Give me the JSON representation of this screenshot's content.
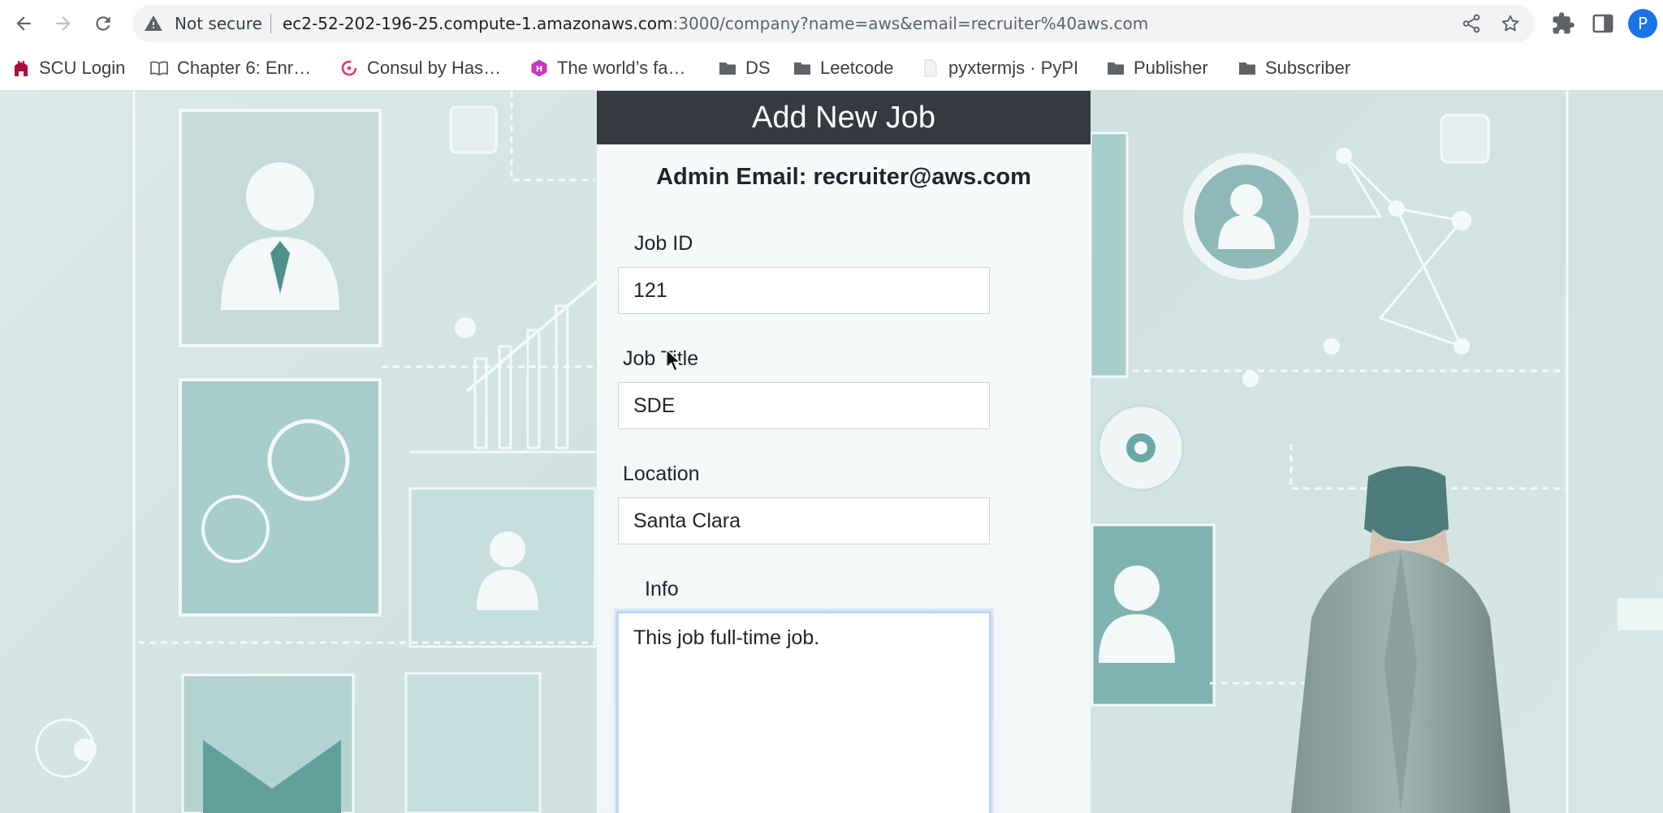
{
  "browser": {
    "security_label": "Not secure",
    "url_host": "ec2-52-202-196-25.compute-1.amazonaws.com",
    "url_rest": ":3000/company?name=aws&email=recruiter%40aws.com",
    "profile_initial": "P"
  },
  "bookmarks": [
    {
      "label": "SCU Login",
      "icon": "scu-logo-icon"
    },
    {
      "label": "Chapter 6: Enr…",
      "icon": "book-icon"
    },
    {
      "label": "Consul by Has…",
      "icon": "consul-logo-icon"
    },
    {
      "label": "The world’s fa…",
      "icon": "hex-logo-icon"
    },
    {
      "label": "DS",
      "icon": "folder-icon"
    },
    {
      "label": "Leetcode",
      "icon": "folder-icon"
    },
    {
      "label": "pyxtermjs · PyPI",
      "icon": "page-icon"
    },
    {
      "label": "Publisher",
      "icon": "folder-icon"
    },
    {
      "label": "Subscriber",
      "icon": "folder-icon"
    }
  ],
  "modal": {
    "title": "Add New Job",
    "admin_email": "Admin Email: recruiter@aws.com",
    "fields": {
      "job_id": {
        "label": "Job ID",
        "value": "121"
      },
      "job_title": {
        "label": "Job Title",
        "value": "SDE"
      },
      "location": {
        "label": "Location",
        "value": "Santa Clara"
      },
      "info": {
        "label": "Info",
        "value": "This job full-time job."
      }
    }
  },
  "colors": {
    "header_bg": "#343a40",
    "accent_focus": "#bcd6f5",
    "background": "#cfe2e1"
  }
}
